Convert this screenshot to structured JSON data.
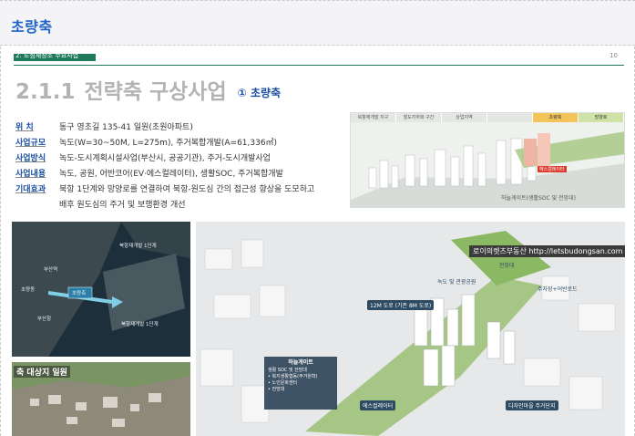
{
  "header": {
    "title": "초량축"
  },
  "doc": {
    "section_label": "2. 도심재창조 주요사업",
    "page_number": "10",
    "title_number": "2.1.1",
    "title_text": "전략축 구상사업",
    "title_sub": "① 초량축",
    "info": [
      {
        "key": "위    치",
        "value": "동구 영초길 135-41 일원(초원아파트)"
      },
      {
        "key": "사업규모",
        "value": "녹도(W=30~50M, L=275m), 주거복합개발(A=61,336㎡)"
      },
      {
        "key": "사업방식",
        "value": "녹도-도시계획시설사업(부산시, 공공기관), 주거-도시개발사업"
      },
      {
        "key": "사업내용",
        "value": "녹도, 공원, 어반코어(EV·에스컬레이터), 생활SOC, 주거복합개발"
      },
      {
        "key": "기대효과",
        "value": "북항 1단계와 망양로를 연결하여 북항-원도심 간의 접근성 향상을 도모하고"
      }
    ],
    "info_continuation": "배후 원도심의 주거 및 보행환경 개선",
    "diagram": {
      "tabs": [
        "북항재개발 지구",
        "철도지하화 구간",
        "상업지역",
        "",
        "초량축",
        "망양로"
      ],
      "red_label": "에스컬레이터",
      "caption": "하늘게이트(생활SOC 및 전망대)"
    },
    "map_labels": [
      "북항재개발 1단계",
      "부산역",
      "초량동",
      "북항재개발 1단계",
      "초량축",
      "부산항"
    ],
    "photo_label": "축 대상지 일원",
    "render": {
      "watermark": "로이의렛츠부동산 http://letsbudongsan.com",
      "labels": [
        "전망대",
        "주차장+어반로드",
        "녹도 및 관광공원",
        "12M 도로 (기존 8M 도로)",
        "에스컬레이터",
        "디자인마을 주거단지"
      ],
      "callout_title": "하늘게이트",
      "callout_lines": [
        "생활 SOC 및 전망대",
        "• 복지생활협동(주거원학)",
        "• 노인문화센터",
        "• 전망대"
      ]
    }
  },
  "colors": {
    "accent": "#1f63c8",
    "section": "#1f7a5a",
    "key_text": "#1a4fa0"
  }
}
